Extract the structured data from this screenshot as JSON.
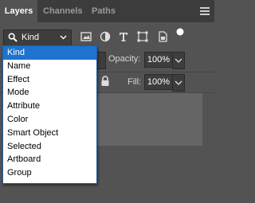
{
  "tabs": [
    {
      "label": "Layers",
      "active": true
    },
    {
      "label": "Channels",
      "active": false
    },
    {
      "label": "Paths",
      "active": false
    }
  ],
  "filter": {
    "selected": "Kind",
    "icons": [
      "pixel-filter-icon",
      "adjustment-filter-icon",
      "type-filter-icon",
      "shape-filter-icon",
      "smart-object-filter-icon",
      "filter-toggle-icon"
    ]
  },
  "opacity": {
    "label": "Opacity:",
    "value": "100%"
  },
  "fill": {
    "label": "Fill:",
    "value": "100%"
  },
  "dropdown": {
    "items": [
      "Kind",
      "Name",
      "Effect",
      "Mode",
      "Attribute",
      "Color",
      "Smart Object",
      "Selected",
      "Artboard",
      "Group"
    ],
    "selected_index": 0
  },
  "colors": {
    "selection": "#1e73cf",
    "panel": "#535353",
    "tabbar": "#3c3c3c"
  }
}
